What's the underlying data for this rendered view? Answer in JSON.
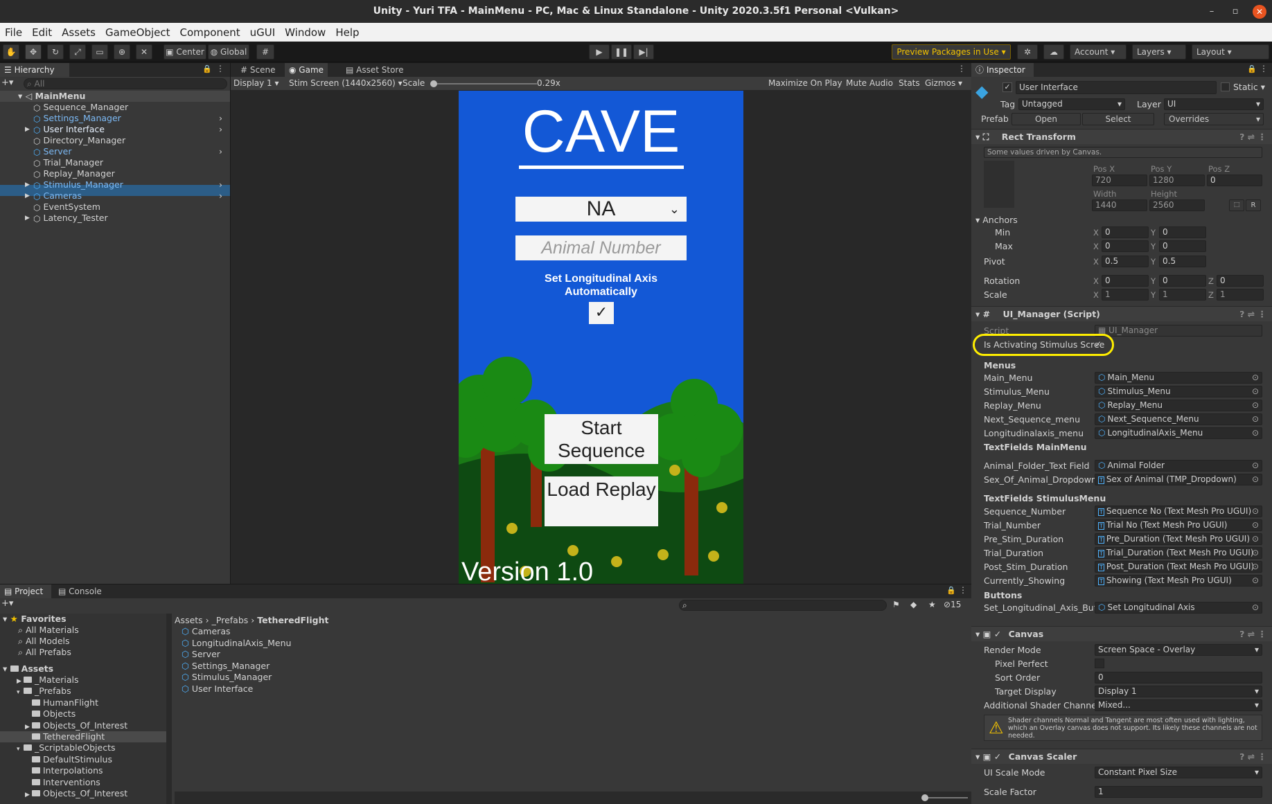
{
  "window": {
    "title": "Unity - Yuri TFA - MainMenu - PC, Mac & Linux Standalone - Unity 2020.3.5f1 Personal <Vulkan>",
    "min": "–",
    "max": "▫",
    "close": "✕"
  },
  "menu": [
    "File",
    "Edit",
    "Assets",
    "GameObject",
    "Component",
    "uGUI",
    "Window",
    "Help"
  ],
  "toolbar": {
    "center": "Center",
    "global": "Global",
    "preview": "Preview Packages in Use",
    "account": "Account",
    "layers": "Layers",
    "layout": "Layout"
  },
  "hierarchy": {
    "tab": "Hierarchy",
    "search": "All",
    "root": "MainMenu",
    "items": [
      {
        "label": "Sequence_Manager",
        "blue": false
      },
      {
        "label": "Settings_Manager",
        "blue": true
      },
      {
        "label": "User Interface",
        "blue": true
      },
      {
        "label": "Directory_Manager",
        "blue": false
      },
      {
        "label": "Server",
        "blue": true
      },
      {
        "label": "Trial_Manager",
        "blue": false
      },
      {
        "label": "Replay_Manager",
        "blue": false
      },
      {
        "label": "Stimulus_Manager",
        "blue": true
      },
      {
        "label": "Cameras",
        "blue": true
      },
      {
        "label": "EventSystem",
        "blue": false
      },
      {
        "label": "Latency_Tester",
        "blue": false
      }
    ]
  },
  "game": {
    "tabs": [
      "Scene",
      "Game",
      "Asset Store"
    ],
    "display": "Display 1",
    "resolution": "Stim Screen (1440x2560)",
    "scale_label": "Scale",
    "scale_value": "0.29x",
    "right_buttons": [
      "Maximize On Play",
      "Mute Audio",
      "Stats",
      "Gizmos"
    ],
    "title": "CAVE",
    "dropdown": "NA",
    "placeholder": "Animal Number",
    "axis_label": "Set Longitudinal Axis Automatically",
    "start": "Start Sequence",
    "load": "Load Replay",
    "version": "Version 1.0"
  },
  "project": {
    "tabs": [
      "Project",
      "Console"
    ],
    "count": "15",
    "favorites": "Favorites",
    "fav_items": [
      "All Materials",
      "All Models",
      "All Prefabs"
    ],
    "assets": "Assets",
    "tree": [
      "_Materials",
      "_Prefabs",
      "HumanFlight",
      "Objects",
      "Objects_Of_Interest",
      "TetheredFlight",
      "_ScriptableObjects",
      "DefaultStimulus",
      "Interpolations",
      "Interventions",
      "Objects_Of_Interest"
    ],
    "breadcrumb": [
      "Assets",
      "_Prefabs",
      "TetheredFlight"
    ],
    "files": [
      "Cameras",
      "LongitudinalAxis_Menu",
      "Server",
      "Settings_Manager",
      "Stimulus_Manager",
      "User Interface"
    ]
  },
  "inspector": {
    "tab": "Inspector",
    "name": "User Interface",
    "static": "Static",
    "tag_label": "Tag",
    "tag": "Untagged",
    "layer_label": "Layer",
    "layer": "UI",
    "prefab": "Prefab",
    "open": "Open",
    "select": "Select",
    "overrides": "Overrides",
    "rect": {
      "title": "Rect Transform",
      "note": "Some values driven by Canvas.",
      "posx_l": "Pos X",
      "posy_l": "Pos Y",
      "posz_l": "Pos Z",
      "posx": "720",
      "posy": "1280",
      "posz": "0",
      "w_l": "Width",
      "h_l": "Height",
      "w": "1440",
      "h": "2560",
      "anchors": "Anchors",
      "min": "Min",
      "max": "Max",
      "pivot": "Pivot",
      "rotation": "Rotation",
      "scale": "Scale",
      "ax": "0",
      "ay": "0",
      "mx": "0",
      "my": "0",
      "px": "0.5",
      "py": "0.5",
      "rx": "0",
      "ry": "0",
      "rz": "0",
      "sx": "1",
      "sy": "1",
      "sz": "1"
    },
    "ui": {
      "title": "UI_Manager (Script)",
      "script_l": "Script",
      "script": "UI_Manager",
      "activating": "Is Activating Stimulus Scree",
      "menus": "Menus",
      "menu_rows": [
        [
          "Main_Menu",
          "Main_Menu"
        ],
        [
          "Stimulus_Menu",
          "Stimulus_Menu"
        ],
        [
          "Replay_Menu",
          "Replay_Menu"
        ],
        [
          "Next_Sequence_menu",
          "Next_Sequence_Menu"
        ],
        [
          "Longitudinalaxis_menu",
          "LongitudinalAxis_Menu"
        ]
      ],
      "tf_main": "TextFields MainMenu",
      "main_rows": [
        [
          "Animal_Folder_Text Field",
          "Animal Folder"
        ],
        [
          "Sex_Of_Animal_Dropdown",
          "Sex of Animal (TMP_Dropdown)"
        ]
      ],
      "tf_stim": "TextFields StimulusMenu",
      "stim_rows": [
        [
          "Sequence_Number",
          "Sequence No (Text Mesh Pro UGUI)"
        ],
        [
          "Trial_Number",
          "Trial No (Text Mesh Pro UGUI)"
        ],
        [
          "Pre_Stim_Duration",
          "Pre_Duration (Text Mesh Pro UGUI)"
        ],
        [
          "Trial_Duration",
          "Trial_Duration (Text Mesh Pro UGUI)"
        ],
        [
          "Post_Stim_Duration",
          "Post_Duration (Text Mesh Pro UGUI)"
        ],
        [
          "Currently_Showing",
          "Showing (Text Mesh Pro UGUI)"
        ]
      ],
      "buttons": "Buttons",
      "btn_row": [
        "Set_Longitudinal_Axis_Butto",
        "Set Longitudinal Axis"
      ]
    },
    "canvas": {
      "title": "Canvas",
      "render_l": "Render Mode",
      "render": "Screen Space - Overlay",
      "pixel_l": "Pixel Perfect",
      "sort_l": "Sort Order",
      "sort": "0",
      "target_l": "Target Display",
      "target": "Display 1",
      "shader_l": "Additional Shader Channels",
      "shader": "Mixed...",
      "warning": "Shader channels Normal and Tangent are most often used with lighting, which an Overlay canvas does not support. Its likely these channels are not needed."
    },
    "scaler": {
      "title": "Canvas Scaler",
      "mode_l": "UI Scale Mode",
      "mode": "Constant Pixel Size",
      "factor_l": "Scale Factor",
      "factor": "1"
    }
  },
  "colors": {
    "accent": "#2c5d87",
    "highlight": "#ffee00",
    "sky": "#1358d6",
    "ground": "#0e4a12"
  }
}
